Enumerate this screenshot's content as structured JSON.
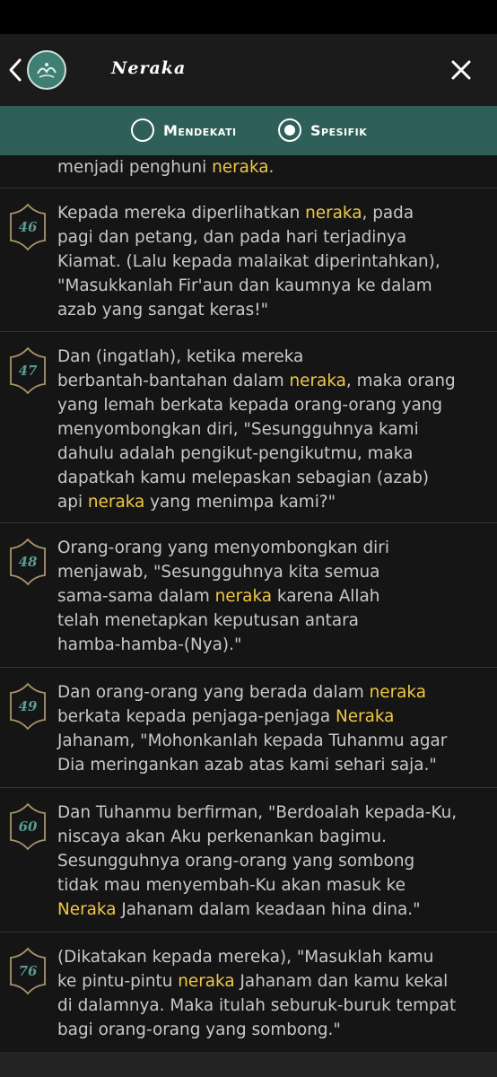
{
  "appbar": {
    "title": "Neraka",
    "back_icon": "chevron-left-icon",
    "logo_icon": "quran-logo-icon",
    "close_icon": "close-icon"
  },
  "filter": {
    "options": [
      {
        "label": "Mendekati",
        "selected": false
      },
      {
        "label": "Spesifik",
        "selected": true
      }
    ]
  },
  "colors": {
    "highlight": "#f2c744",
    "accent": "#2e5f58",
    "badge": "#5a9b93",
    "badge_outline": "#a8946a"
  },
  "partial_verse": {
    "parts": [
      "menjadi penghuni ",
      {
        "hl": "neraka"
      },
      "."
    ]
  },
  "verses": [
    {
      "number": "46",
      "parts": [
        "Kepada mereka diperlihatkan ",
        {
          "hl": "neraka"
        },
        ", pada\npagi dan petang, dan pada hari terjadinya\nKiamat. (Lalu kepada malaikat diperintahkan),\n\"Masukkanlah Fir'aun dan kaumnya ke dalam\nazab yang sangat keras!\""
      ]
    },
    {
      "number": "47",
      "parts": [
        "Dan (ingatlah), ketika mereka\nberbantah-bantahan dalam ",
        {
          "hl": "neraka"
        },
        ", maka orang\nyang lemah berkata kepada orang-orang yang\nmenyombongkan diri, \"Sesungguhnya kami\ndahulu adalah pengikut-pengikutmu, maka\ndapatkah kamu melepaskan sebagian (azab)\napi ",
        {
          "hl": "neraka"
        },
        " yang menimpa kami?\""
      ]
    },
    {
      "number": "48",
      "parts": [
        "Orang-orang yang menyombongkan diri\nmenjawab, \"Sesungguhnya kita semua\nsama-sama dalam ",
        {
          "hl": "neraka"
        },
        " karena Allah\ntelah menetapkan keputusan antara\nhamba-hamba-(Nya).\""
      ]
    },
    {
      "number": "49",
      "parts": [
        "Dan orang-orang yang berada dalam ",
        {
          "hl": "neraka"
        },
        "\nberkata kepada penjaga-penjaga ",
        {
          "hl": "Neraka"
        },
        "\nJahanam, \"Mohonkanlah kepada Tuhanmu agar\nDia meringankan azab atas kami sehari saja.\""
      ]
    },
    {
      "number": "60",
      "parts": [
        "Dan Tuhanmu berfirman, \"Berdoalah kepada-Ku,\nniscaya akan Aku perkenankan bagimu.\nSesungguhnya orang-orang yang sombong\ntidak mau menyembah-Ku akan masuk ke\n",
        {
          "hl": "Neraka"
        },
        " Jahanam dalam keadaan hina dina.\""
      ]
    },
    {
      "number": "76",
      "parts": [
        "(Dikatakan kepada mereka), \"Masuklah kamu\nke pintu-pintu ",
        {
          "hl": "neraka"
        },
        " Jahanam dan kamu kekal\ndi dalamnya. Maka itulah seburuk-buruk tempat\nbagi orang-orang yang sombong.\""
      ]
    }
  ]
}
